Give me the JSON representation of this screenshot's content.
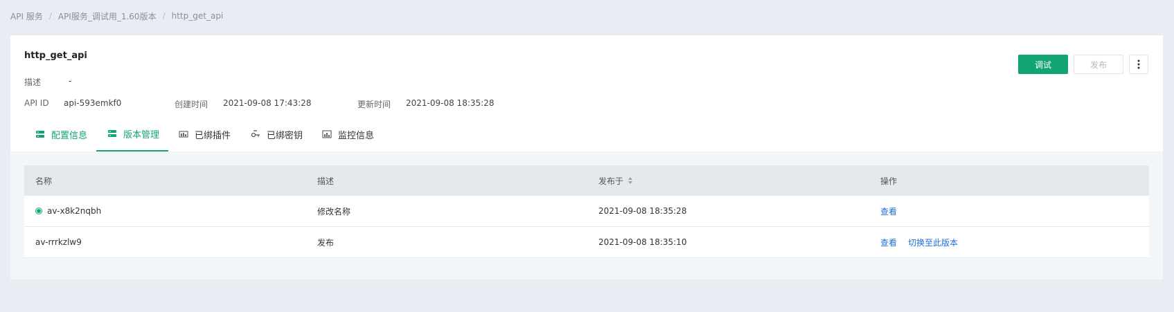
{
  "breadcrumb": [
    "API 服务",
    "API服务_调试用_1.60版本",
    "http_get_api"
  ],
  "api": {
    "name": "http_get_api",
    "desc_label": "描述",
    "desc_value": "-",
    "id_label": "API ID",
    "id_value": "api-593emkf0",
    "created_label": "创建时间",
    "created_value": "2021-09-08 17:43:28",
    "updated_label": "更新时间",
    "updated_value": "2021-09-08 18:35:28"
  },
  "actions": {
    "debug": "调试",
    "publish": "发布"
  },
  "tabs": [
    {
      "label": "配置信息",
      "icon": "config-icon"
    },
    {
      "label": "版本管理",
      "icon": "version-icon"
    },
    {
      "label": "已绑插件",
      "icon": "plugin-icon"
    },
    {
      "label": "已绑密钥",
      "icon": "key-icon"
    },
    {
      "label": "监控信息",
      "icon": "monitor-icon"
    }
  ],
  "table": {
    "columns": [
      "名称",
      "描述",
      "发布于",
      "操作"
    ],
    "rows": [
      {
        "name": "av-x8k2nqbh",
        "current": true,
        "desc": "修改名称",
        "published": "2021-09-08 18:35:28",
        "actions": [
          "查看"
        ]
      },
      {
        "name": "av-rrrkzlw9",
        "current": false,
        "desc": "发布",
        "published": "2021-09-08 18:35:10",
        "actions": [
          "查看",
          "切换至此版本"
        ]
      }
    ]
  },
  "colors": {
    "accent": "#13a474",
    "link": "#1a6fd8",
    "page_bg": "#e8edf3"
  }
}
